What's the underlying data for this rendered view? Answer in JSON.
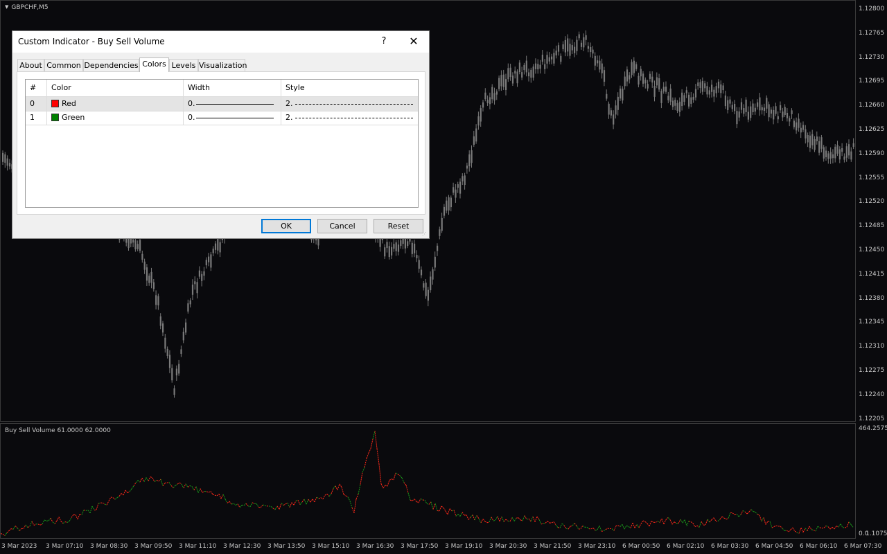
{
  "chart": {
    "symbol": "GBPCHF,M5",
    "price_ticks": [
      "1.12800",
      "1.12765",
      "1.12730",
      "1.12695",
      "1.12660",
      "1.12625",
      "1.12590",
      "1.12555",
      "1.12520",
      "1.12485",
      "1.12450",
      "1.12415",
      "1.12380",
      "1.12345",
      "1.12310",
      "1.12275",
      "1.12240",
      "1.12205"
    ],
    "time_ticks": [
      "3 Mar 2023",
      "3 Mar 07:10",
      "3 Mar 08:30",
      "3 Mar 09:50",
      "3 Mar 11:10",
      "3 Mar 12:30",
      "3 Mar 13:50",
      "3 Mar 15:10",
      "3 Mar 16:30",
      "3 Mar 17:50",
      "3 Mar 19:10",
      "3 Mar 20:30",
      "3 Mar 21:50",
      "3 Mar 23:10",
      "6 Mar 00:50",
      "6 Mar 02:10",
      "6 Mar 03:30",
      "6 Mar 04:50",
      "6 Mar 06:10",
      "6 Mar 07:30"
    ],
    "indicator_label": "Buy Sell Volume 61.0000 62.0000",
    "sub_top_value": "464.2575",
    "sub_bottom_value": "0.0",
    "sub_bottom_value2": "1.1075",
    "colors": {
      "candle": "#7a7a7a",
      "red": "#ff2a1a",
      "green": "#1a9a1a",
      "background": "#0a0a0d"
    }
  },
  "dialog": {
    "title": "Custom Indicator - Buy Sell Volume",
    "help": "?",
    "close": "✕",
    "tabs": [
      "About",
      "Common",
      "Dependencies",
      "Colors",
      "Levels",
      "Visualization"
    ],
    "active_tab": "Colors",
    "table": {
      "headers": [
        "#",
        "Color",
        "Width",
        "Style"
      ],
      "rows": [
        {
          "index": "0",
          "color_name": "Red",
          "color": "#ff0000",
          "width": "0.",
          "style": "2."
        },
        {
          "index": "1",
          "color_name": "Green",
          "color": "#008000",
          "width": "0.",
          "style": "2."
        }
      ]
    },
    "buttons": {
      "ok": "OK",
      "cancel": "Cancel",
      "reset": "Reset"
    }
  }
}
